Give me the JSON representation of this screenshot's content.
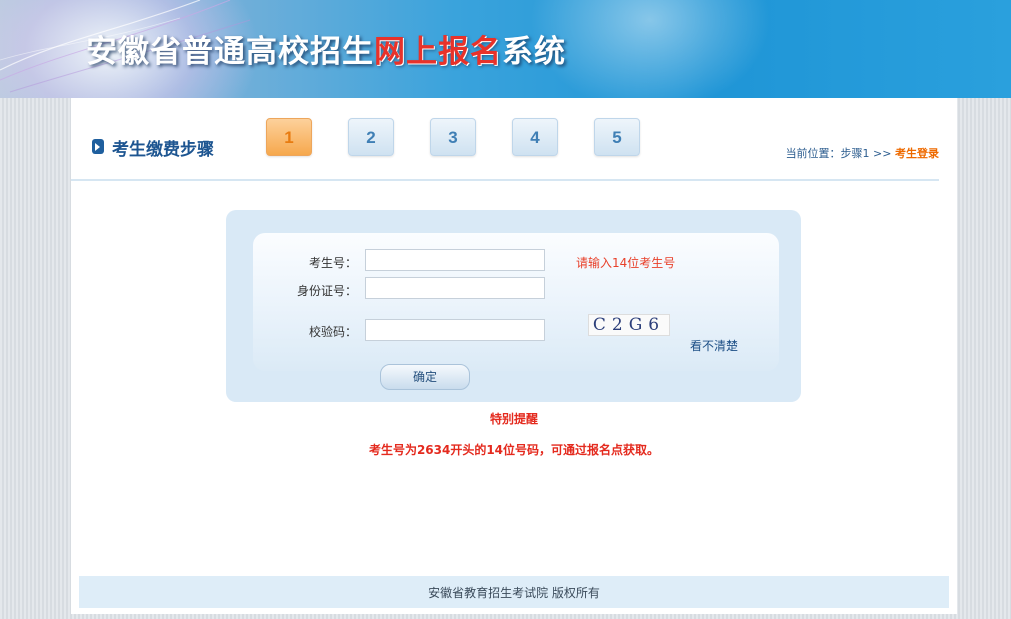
{
  "header": {
    "title_part1": "安徽省普通高校招生",
    "title_highlight": "网上报名",
    "title_part2": "系统"
  },
  "steps": {
    "section_title": "考生缴费步骤",
    "items": [
      {
        "label": "1",
        "active": true
      },
      {
        "label": "2",
        "active": false
      },
      {
        "label": "3",
        "active": false
      },
      {
        "label": "4",
        "active": false
      },
      {
        "label": "5",
        "active": false
      }
    ]
  },
  "location": {
    "prefix": "当前位置：步骤1 >> ",
    "current": "考生登录"
  },
  "form": {
    "exam_no_label": "考生号：",
    "exam_no_value": "",
    "exam_no_hint": "请输入14位考生号",
    "id_label": "身份证号：",
    "id_value": "",
    "code_label": "校验码：",
    "code_value": "",
    "captcha_text": "C2G6",
    "refresh_label": "看不清楚",
    "submit_label": "确定"
  },
  "notice": {
    "title": "特别提醒",
    "text": "考生号为2634开头的14位号码，可通过报名点获取。"
  },
  "footer": {
    "copyright": "安徽省教育招生考试院 版权所有"
  },
  "colors": {
    "brand_blue": "#1d5591",
    "highlight_red": "#e8322a",
    "active_step_orange": "#f6a84d",
    "notice_red": "#e42a1e"
  }
}
